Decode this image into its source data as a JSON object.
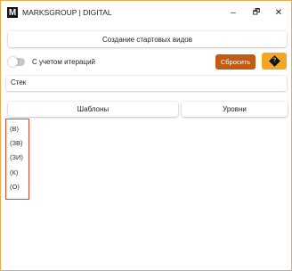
{
  "app": {
    "logo_letter": "M",
    "title": "MARKSGROUP | DIGITAL",
    "controls": {
      "minimize": "–",
      "maximize": "🗗",
      "close": "✕"
    }
  },
  "actions": {
    "create_label": "Создание стартовых видов"
  },
  "options": {
    "iterations_toggle_label": "С учетом итераций",
    "iterations_toggle_on": false,
    "reset_label": "Сбросить",
    "help_symbol": "?"
  },
  "stack": {
    "label": "Стек"
  },
  "tabs": [
    {
      "label": "Шаблоны"
    },
    {
      "label": "Уровни"
    }
  ],
  "list": {
    "items": [
      "(В)",
      "(ЗВ)",
      "(ЗИ)",
      "(К)",
      "(О)"
    ]
  },
  "colors": {
    "accent_border": "#f0a64a",
    "reset_bg": "#c35a11",
    "help_bg": "#f6a623",
    "selection_outline": "#e8462b"
  }
}
